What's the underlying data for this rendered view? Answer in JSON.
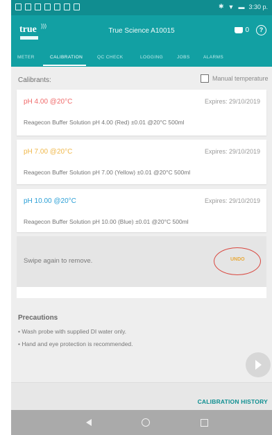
{
  "status_bar": {
    "time": "3:30 p.",
    "icons": [
      "notification-icon",
      "notification-icon",
      "notification-icon",
      "notification-icon",
      "notification-icon",
      "notification-icon",
      "notification-icon"
    ]
  },
  "app_bar": {
    "logo": "true",
    "title": "True Science A10015",
    "cart_count": "0"
  },
  "tabs": [
    {
      "label": "METER"
    },
    {
      "label": "CALIBRATION"
    },
    {
      "label": "QC CHECK"
    },
    {
      "label": "LOGGING"
    },
    {
      "label": "JOBS"
    },
    {
      "label": "ALARMS"
    }
  ],
  "active_tab": "CALIBRATION",
  "calibrants": {
    "label": "Calibrants:",
    "manual_temperature_label": "Manual temperature",
    "manual_temperature_checked": false,
    "cards": [
      {
        "title": "pH 4.00 @20°C",
        "title_color": "#f06a6a",
        "expires": "Expires: 29/10/2019",
        "description": "Reagecon Buffer Solution pH 4.00 (Red) ±0.01 @20°C 500ml"
      },
      {
        "title": "pH 7.00 @20°C",
        "title_color": "#f0b84b",
        "expires": "Expires: 29/10/2019",
        "description": "Reagecon Buffer Solution pH 7.00 (Yellow) ±0.01 @20°C 500ml"
      },
      {
        "title": "pH 10.00 @20°C",
        "title_color": "#2a9fd6",
        "expires": "Expires: 29/10/2019",
        "description": "Reagecon Buffer Solution pH 10.00 (Blue) ±0.01 @20°C 500ml"
      }
    ],
    "swipe": {
      "message": "Swipe again to remove.",
      "undo_label": "UNDO"
    }
  },
  "precautions": {
    "title": "Precautions",
    "items": [
      "• Wash probe with supplied DI water only.",
      "• Hand and eye protection is recommended."
    ]
  },
  "footer": {
    "calibration_history": "CALIBRATION HISTORY"
  },
  "colors": {
    "status_bar": "#108d90",
    "app_bar": "#12a0a3",
    "accent": "#0f8f91",
    "undo_outline": "#d9473f"
  }
}
